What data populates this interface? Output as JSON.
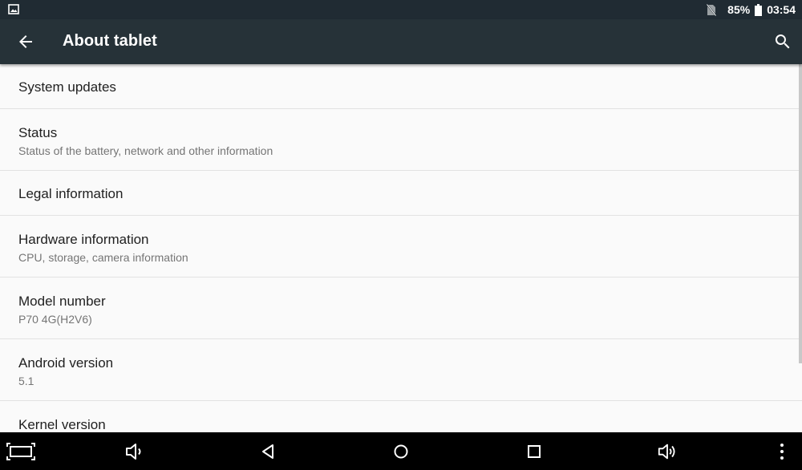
{
  "status_bar": {
    "battery_percent": "85%",
    "time": "03:54",
    "icons": [
      "gallery-icon",
      "no-sim-icon",
      "battery-icon"
    ]
  },
  "app_bar": {
    "title": "About tablet",
    "icons": [
      "back-arrow-icon",
      "search-icon"
    ]
  },
  "settings": [
    {
      "title": "System updates",
      "summary": ""
    },
    {
      "title": "Status",
      "summary": "Status of the battery, network and other information"
    },
    {
      "title": "Legal information",
      "summary": ""
    },
    {
      "title": "Hardware information",
      "summary": "CPU, storage, camera information"
    },
    {
      "title": "Model number",
      "summary": "P70 4G(H2V6)"
    },
    {
      "title": "Android version",
      "summary": "5.1"
    },
    {
      "title": "Kernel version",
      "summary": ""
    }
  ],
  "nav_bar": {
    "icons": [
      "screenshot-icon",
      "volume-down-icon",
      "back-icon",
      "home-icon",
      "recents-icon",
      "volume-up-icon",
      "overflow-menu-icon"
    ]
  }
}
